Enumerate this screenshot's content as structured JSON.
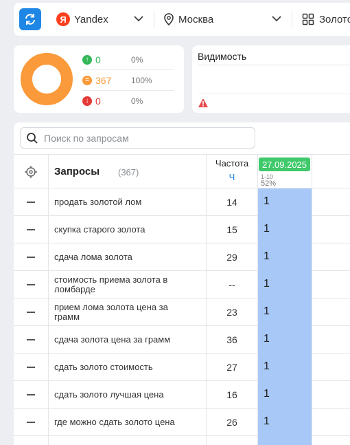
{
  "toolbar": {
    "engine": "Yandex",
    "engine_logo": "Я",
    "region": "Москва",
    "group": "Золото"
  },
  "stats": {
    "up": {
      "value": "0",
      "percent": "0%",
      "color": "#34b759"
    },
    "same": {
      "value": "367",
      "percent": "100%",
      "color": "#fb9a3a"
    },
    "down": {
      "value": "0",
      "percent": "0%",
      "color": "#e53935"
    },
    "donut_color": "#fb9a3a"
  },
  "visibility": {
    "title": "Видимость"
  },
  "search": {
    "placeholder": "Поиск по запросам"
  },
  "table": {
    "queries_title": "Запросы",
    "queries_count": "(367)",
    "freq_title": "Частота",
    "freq_unit": "Ч",
    "date": "27.09.2025",
    "date_range": "1-10",
    "date_percent": "52%",
    "rows": [
      {
        "query": "продать золотой лом",
        "freq": "14",
        "pos": "1"
      },
      {
        "query": "скупка старого золота",
        "freq": "15",
        "pos": "1"
      },
      {
        "query": "сдача лома золота",
        "freq": "29",
        "pos": "1"
      },
      {
        "query": "стоимость приема золота в ломбарде",
        "freq": "--",
        "pos": "1"
      },
      {
        "query": "прием лома золота цена за грамм",
        "freq": "23",
        "pos": "1"
      },
      {
        "query": "сдача золота цена за грамм",
        "freq": "36",
        "pos": "1"
      },
      {
        "query": "сдать золото стоимость",
        "freq": "27",
        "pos": "1"
      },
      {
        "query": "сдать золото лучшая цена",
        "freq": "16",
        "pos": "1"
      },
      {
        "query": "где можно сдать золото цена",
        "freq": "26",
        "pos": "1"
      }
    ]
  }
}
